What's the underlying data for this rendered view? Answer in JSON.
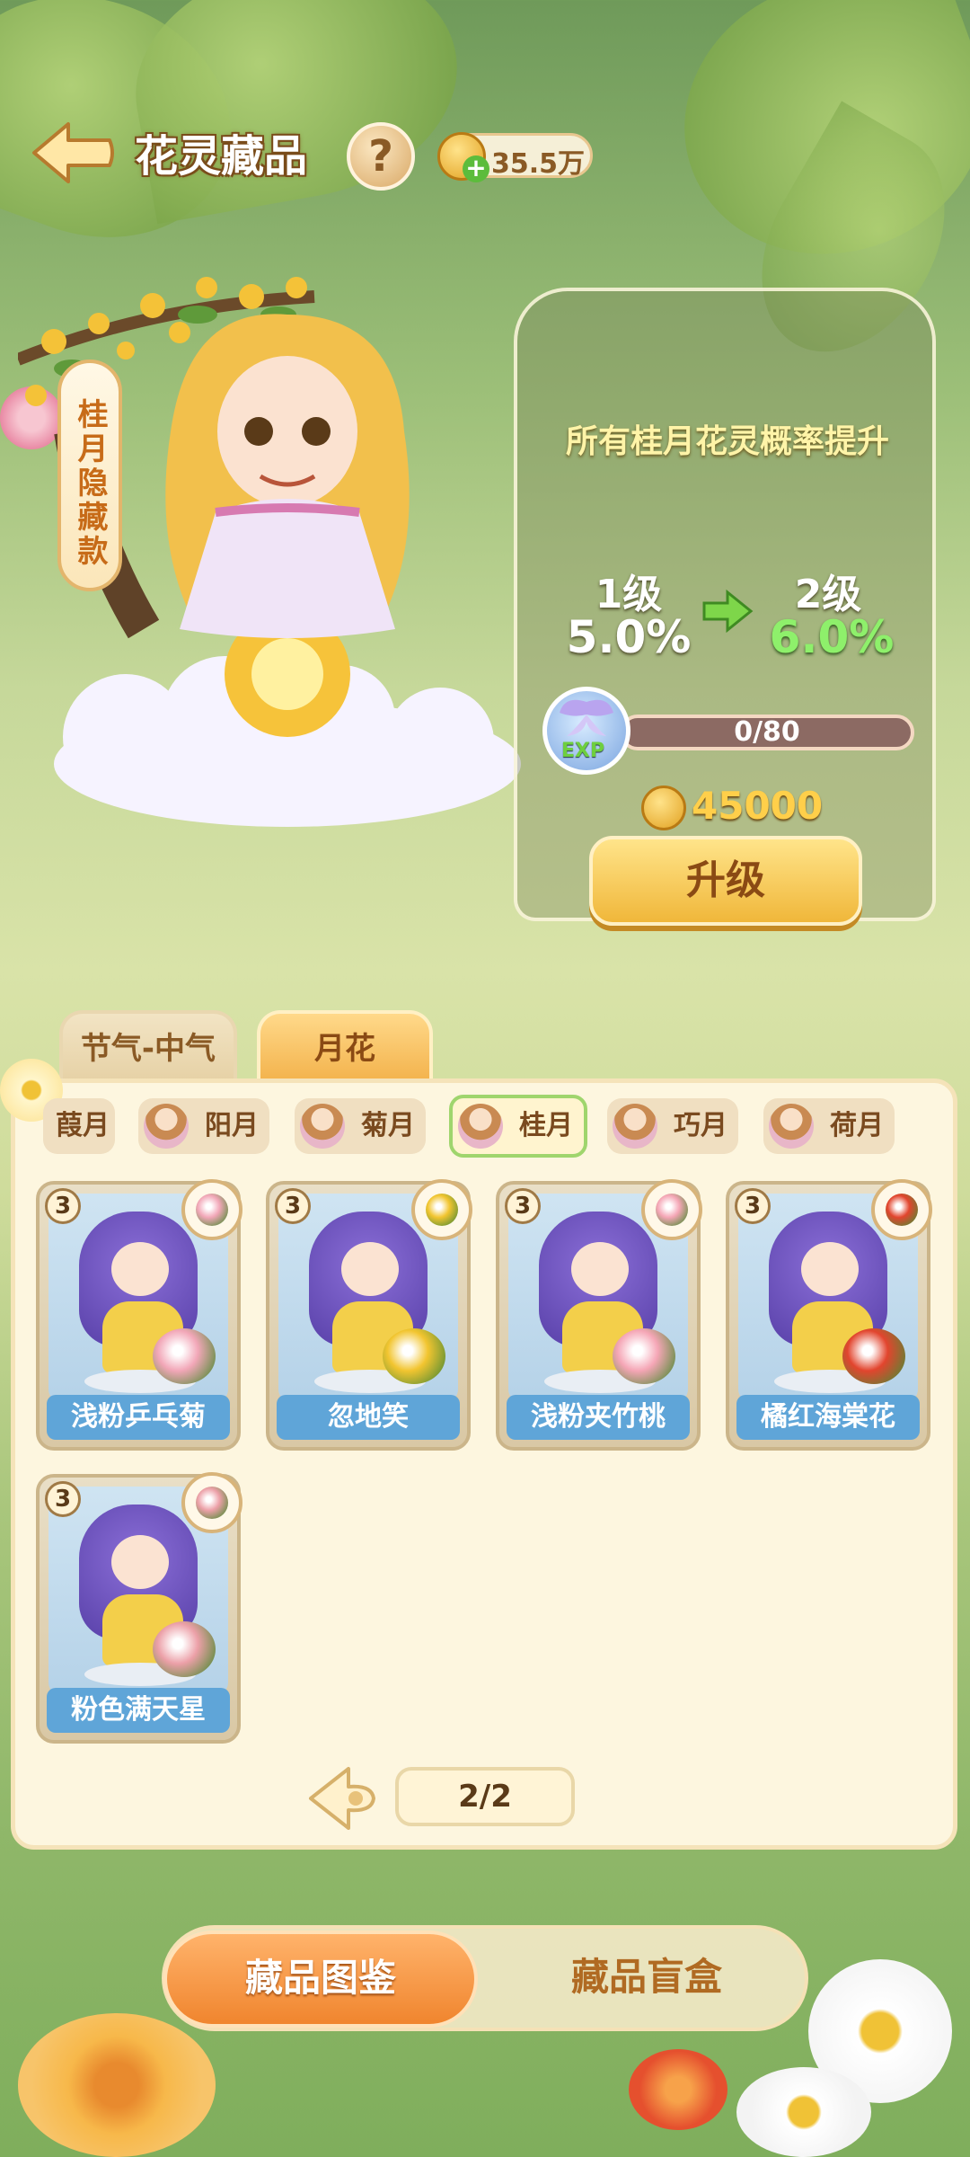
{
  "header": {
    "title": "花灵藏品",
    "help_label": "?",
    "currency": "35.5万"
  },
  "featured": {
    "tag": "桂月隐藏款"
  },
  "upgrade_panel": {
    "title": "所有桂月花灵概率提升",
    "from_level": "1级",
    "from_rate": "5.0%",
    "to_level": "2级",
    "to_rate": "6.0%",
    "exp_icon_text": "EXP",
    "exp_progress": "0/80",
    "exp_fraction": 0,
    "cost": "45000",
    "button_label": "升级"
  },
  "category_tabs": [
    {
      "label": "节气-中气",
      "active": false
    },
    {
      "label": "月花",
      "active": true
    }
  ],
  "sub_tabs": [
    {
      "label": "葭月",
      "active": false
    },
    {
      "label": "阳月",
      "active": false
    },
    {
      "label": "菊月",
      "active": false
    },
    {
      "label": "桂月",
      "active": true
    },
    {
      "label": "巧月",
      "active": false
    },
    {
      "label": "荷月",
      "active": false
    }
  ],
  "cards": [
    {
      "level": "3",
      "name": "浅粉乒乓菊",
      "flower_color": "#f2a7b8"
    },
    {
      "level": "3",
      "name": "忽地笑",
      "flower_color": "#f2c530"
    },
    {
      "level": "3",
      "name": "浅粉夹竹桃",
      "flower_color": "#f5a6b6"
    },
    {
      "level": "3",
      "name": "橘红海棠花",
      "flower_color": "#e2452e"
    },
    {
      "level": "3",
      "name": "粉色满天星",
      "flower_color": "#eca0a8"
    }
  ],
  "pager": {
    "current": "2/2"
  },
  "bottom_tabs": {
    "active": "藏品图鉴",
    "inactive": "藏品盲盒"
  },
  "colors": {
    "accent": "#f0852e",
    "rate_up": "#8ef06b",
    "card_name_bg": "#5fa5d8"
  }
}
